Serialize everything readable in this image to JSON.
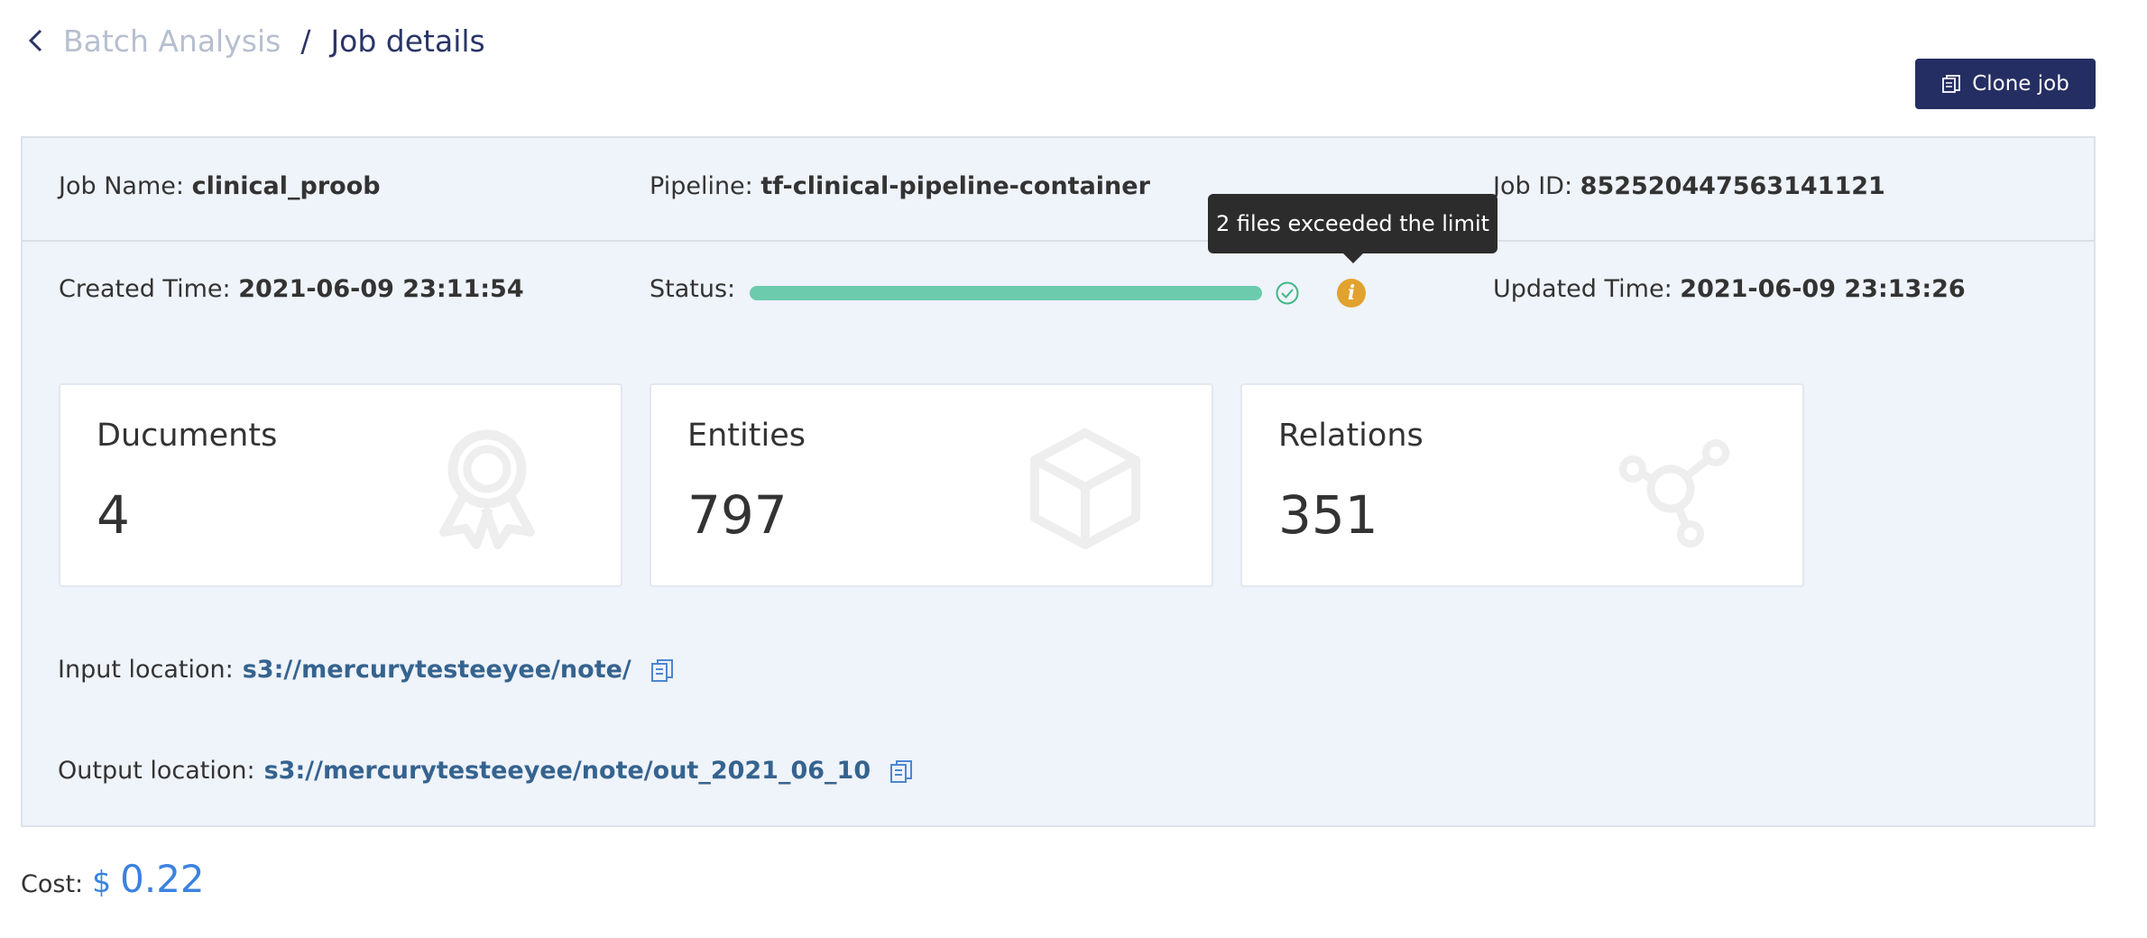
{
  "breadcrumb": {
    "parent": "Batch Analysis",
    "separator": "/",
    "current": "Job details"
  },
  "toolbar": {
    "clone_label": "Clone job"
  },
  "job": {
    "name_label": "Job Name:",
    "name_value": "clinical_proob",
    "pipeline_label": "Pipeline:",
    "pipeline_value": "tf-clinical-pipeline-container",
    "id_label": "Job ID:",
    "id_value": "852520447563141121",
    "created_label": "Created Time:",
    "created_value": "2021-06-09 23:11:54",
    "status_label": "Status:",
    "status_progress": 1.0,
    "updated_label": "Updated Time:",
    "updated_value": "2021-06-09 23:13:26"
  },
  "tooltip": {
    "text": "2 files exceeded the limit"
  },
  "info_icon_glyph": "i",
  "cards": [
    {
      "title": "Ducuments",
      "value": "4",
      "icon": "award-icon"
    },
    {
      "title": "Entities",
      "value": "797",
      "icon": "cube-icon"
    },
    {
      "title": "Relations",
      "value": "351",
      "icon": "network-icon"
    }
  ],
  "locations": {
    "input_label": "Input location:",
    "input_value": "s3://mercurytesteeyee/note/",
    "output_label": "Output location:",
    "output_value": "s3://mercurytesteeyee/note/out_2021_06_10"
  },
  "cost": {
    "label": "Cost:",
    "currency": "$",
    "value": "0.22"
  },
  "colors": {
    "primary": "#252e62",
    "status_bar": "#6ccbad",
    "warning": "#e2a22e",
    "link": "#35638f",
    "cost": "#3b82e0"
  }
}
